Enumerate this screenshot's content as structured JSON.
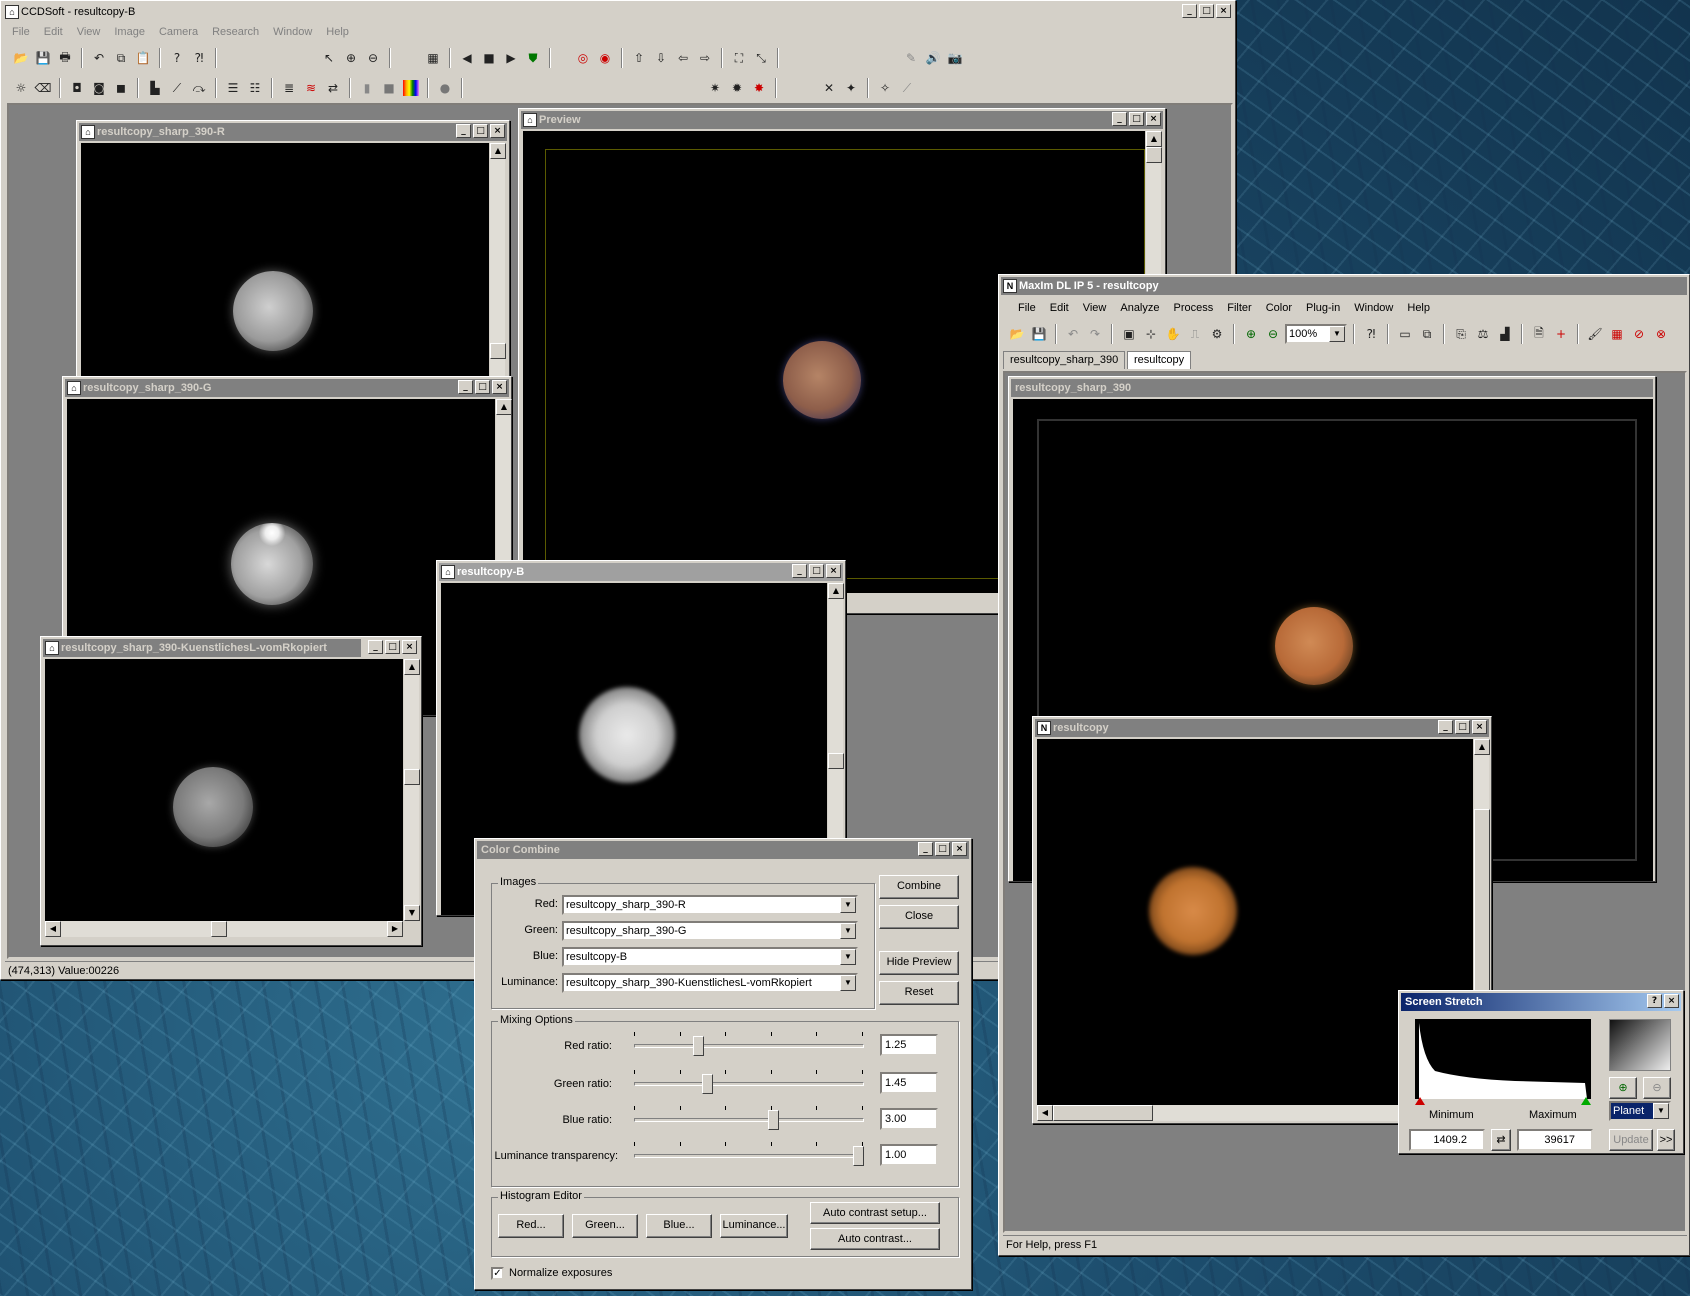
{
  "ccdsoft": {
    "title": "CCDSoft - resultcopy-B",
    "menu": [
      "File",
      "Edit",
      "View",
      "Image",
      "Camera",
      "Research",
      "Window",
      "Help"
    ],
    "status": "(474,313) Value:00226"
  },
  "win_r": {
    "title": "resultcopy_sharp_390-R"
  },
  "win_g": {
    "title": "resultcopy_sharp_390-G"
  },
  "win_l": {
    "title": "resultcopy_sharp_390-KuenstlichesL-vomRkopiert"
  },
  "win_b": {
    "title": "resultcopy-B"
  },
  "preview": {
    "title": "Preview"
  },
  "maxim": {
    "title": "MaxIm DL IP 5 - resultcopy",
    "menu": [
      "File",
      "Edit",
      "View",
      "Analyze",
      "Process",
      "Filter",
      "Color",
      "Plug-in",
      "Window",
      "Help"
    ],
    "zoom": "100%",
    "tabs": [
      "resultcopy_sharp_390",
      "resultcopy"
    ],
    "status": "For Help, press F1"
  },
  "maxim_img1": {
    "title": "resultcopy_sharp_390"
  },
  "maxim_img2": {
    "title": "resultcopy"
  },
  "color_combine": {
    "title": "Color Combine",
    "images_group": "Images",
    "red_label": "Red:",
    "red_value": "resultcopy_sharp_390-R",
    "green_label": "Green:",
    "green_value": "resultcopy_sharp_390-G",
    "blue_label": "Blue:",
    "blue_value": "resultcopy-B",
    "lum_label": "Luminance:",
    "lum_value": "resultcopy_sharp_390-KuenstlichesL-vomRkopiert",
    "combine": "Combine",
    "close": "Close",
    "hide_preview": "Hide Preview",
    "reset": "Reset",
    "mixing_group": "Mixing Options",
    "red_ratio_label": "Red ratio:",
    "red_ratio": "1.25",
    "red_ratio_pos": 0.27,
    "green_ratio_label": "Green ratio:",
    "green_ratio": "1.45",
    "green_ratio_pos": 0.31,
    "blue_ratio_label": "Blue ratio:",
    "blue_ratio": "3.00",
    "blue_ratio_pos": 0.61,
    "lum_trans_label": "Luminance transparency:",
    "lum_trans": "1.00",
    "lum_trans_pos": 1.0,
    "hist_group": "Histogram Editor",
    "red_btn": "Red...",
    "green_btn": "Green...",
    "blue_btn": "Blue...",
    "lum_btn": "Luminance...",
    "auto_setup": "Auto contrast setup...",
    "auto_contrast": "Auto contrast...",
    "normalize": "Normalize exposures",
    "normalize_checked": true
  },
  "screen_stretch": {
    "title": "Screen Stretch",
    "min_label": "Minimum",
    "max_label": "Maximum",
    "min_value": "1409.2",
    "max_value": "39617",
    "mode": "Planet",
    "update": "Update",
    "more": ">>"
  }
}
